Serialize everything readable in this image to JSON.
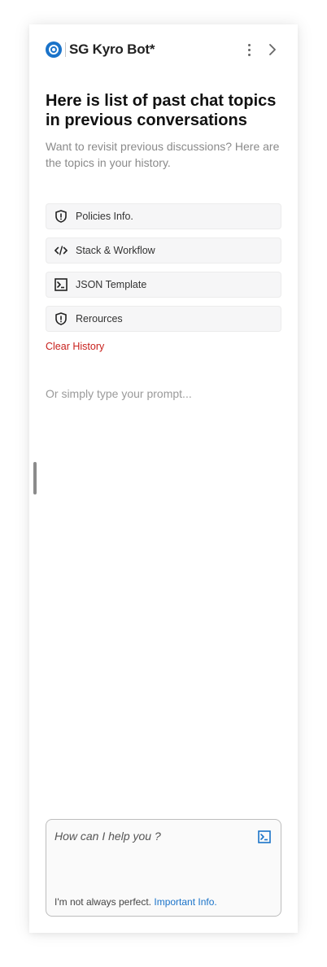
{
  "header": {
    "title": "SG Kyro Bot*",
    "brand_color": "#1a73c9",
    "menu_icon": "kebab-icon",
    "collapse_icon": "chevron-right-icon"
  },
  "intro": {
    "heading": "Here is list of past chat topics in previous conversations",
    "subheading": "Want to revisit previous discussions? Here are the topics in your history."
  },
  "topics": [
    {
      "label": "Policies Info.",
      "icon": "shield-icon"
    },
    {
      "label": "Stack & Workflow",
      "icon": "code-icon"
    },
    {
      "label": "JSON Template",
      "icon": "terminal-icon"
    },
    {
      "label": "Rerources",
      "icon": "shield-icon"
    }
  ],
  "clear_history": {
    "label": "Clear History",
    "color": "#c8201c"
  },
  "prompt_hint": "Or simply type your prompt...",
  "input": {
    "placeholder": "How can I help you ?",
    "send_icon": "send-terminal-icon",
    "disclaimer_text": "I'm not always perfect.",
    "disclaimer_link": "Important Info."
  }
}
